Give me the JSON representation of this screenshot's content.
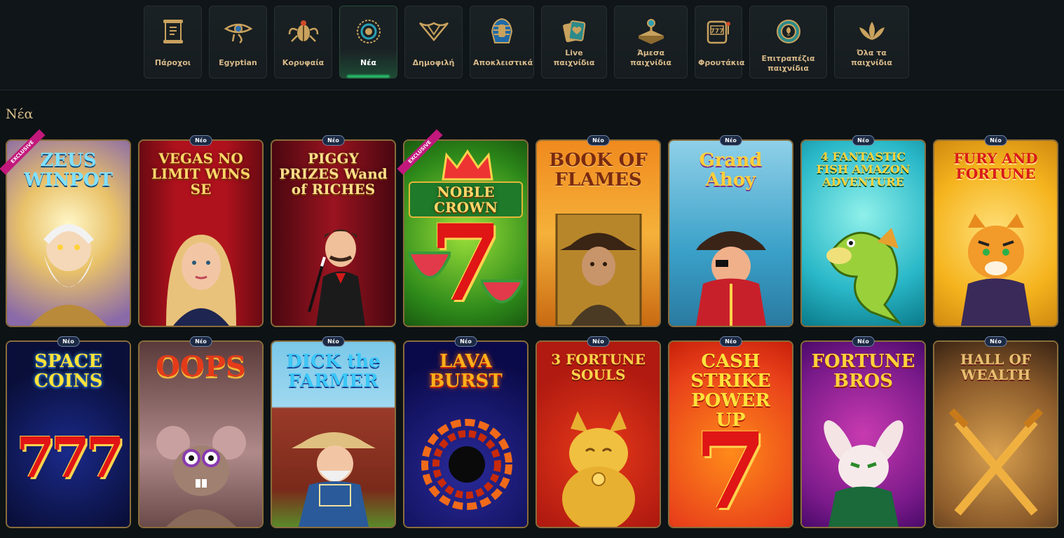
{
  "nav": {
    "categories": [
      {
        "label": "Πάροχοι",
        "icon": "scroll-icon",
        "active": false
      },
      {
        "label": "Egyptian",
        "icon": "eye-of-horus-icon",
        "active": false
      },
      {
        "label": "Κορυφαία",
        "icon": "scarab-icon",
        "active": false
      },
      {
        "label": "Νέα",
        "icon": "sun-emblem-icon",
        "active": true
      },
      {
        "label": "Δημοφιλή",
        "icon": "lotus-emblem-icon",
        "active": false
      },
      {
        "label": "Αποκλειστικά",
        "icon": "pharaoh-icon",
        "active": false
      },
      {
        "label": "Live παιχνίδια",
        "icon": "cards-icon",
        "active": false
      },
      {
        "label": "Άμεσα παιχνίδια",
        "icon": "joystick-icon",
        "active": false
      },
      {
        "label": "Φρουτάκια",
        "icon": "slot-machine-icon",
        "active": false
      },
      {
        "label": "Επιτραπέζια παιχνίδια",
        "icon": "poker-chip-icon",
        "active": false
      },
      {
        "label": "Όλα τα παιχνίδια",
        "icon": "lotus-icon",
        "active": false
      }
    ]
  },
  "section": {
    "title": "Νέα"
  },
  "badges": {
    "new": "Νέο",
    "exclusive": "EXCLUSIVE"
  },
  "games": [
    {
      "title": "ZEUS WINPOT",
      "exclusive": true,
      "new": false,
      "theme": "zeus"
    },
    {
      "title": "VEGAS NO LIMIT WINS SE",
      "exclusive": false,
      "new": true,
      "theme": "vegas"
    },
    {
      "title": "PIGGY PRIZES Wand of RICHES",
      "exclusive": false,
      "new": true,
      "theme": "piggy"
    },
    {
      "title": "NOBLE CROWN",
      "exclusive": true,
      "new": false,
      "theme": "noble"
    },
    {
      "title": "BOOK OF FLAMES",
      "exclusive": false,
      "new": true,
      "theme": "book"
    },
    {
      "title": "Grand Ahoy",
      "exclusive": false,
      "new": true,
      "theme": "ahoy"
    },
    {
      "title": "4 FANTASTIC FISH AMAZON ADVENTURE",
      "exclusive": false,
      "new": true,
      "theme": "fish"
    },
    {
      "title": "FURY AND FORTUNE",
      "exclusive": false,
      "new": true,
      "theme": "fury"
    },
    {
      "title": "SPACE COINS",
      "exclusive": false,
      "new": true,
      "theme": "space"
    },
    {
      "title": "OOPS",
      "exclusive": false,
      "new": true,
      "theme": "oops"
    },
    {
      "title": "DICK the FARMER",
      "exclusive": false,
      "new": true,
      "theme": "farmer"
    },
    {
      "title": "LAVA BURST",
      "exclusive": false,
      "new": true,
      "theme": "lava"
    },
    {
      "title": "3 FORTUNE SOULS",
      "exclusive": false,
      "new": true,
      "theme": "souls"
    },
    {
      "title": "CASH STRIKE POWER UP",
      "exclusive": false,
      "new": true,
      "theme": "cash"
    },
    {
      "title": "FORTUNE BROS",
      "exclusive": false,
      "new": true,
      "theme": "bros"
    },
    {
      "title": "HALL OF WEALTH",
      "exclusive": false,
      "new": true,
      "theme": "hall"
    }
  ]
}
